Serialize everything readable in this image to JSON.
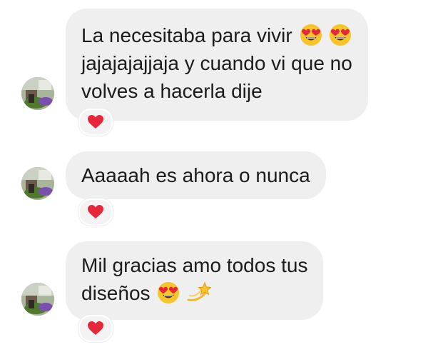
{
  "messages": [
    {
      "lines": [
        "La necesitaba para vivir",
        "jajajajajjaja y cuando vi que no",
        "volves a hacerla dije"
      ],
      "line1_emojis": [
        "heart-eyes-emoji",
        "heart-eyes-emoji"
      ],
      "reaction": "red-heart-emoji"
    },
    {
      "lines": [
        "Aaaaah es ahora o nunca"
      ],
      "reaction": "red-heart-emoji"
    },
    {
      "lines": [
        "Mil gracias amo todos tus",
        "diseños"
      ],
      "line2_emojis": [
        "heart-eyes-emoji",
        "dizzy-emoji"
      ],
      "reaction": "red-heart-emoji"
    }
  ],
  "colors": {
    "bubble_bg": "#efeff0",
    "text": "#1c1c1c",
    "heart": "#e8263a"
  }
}
